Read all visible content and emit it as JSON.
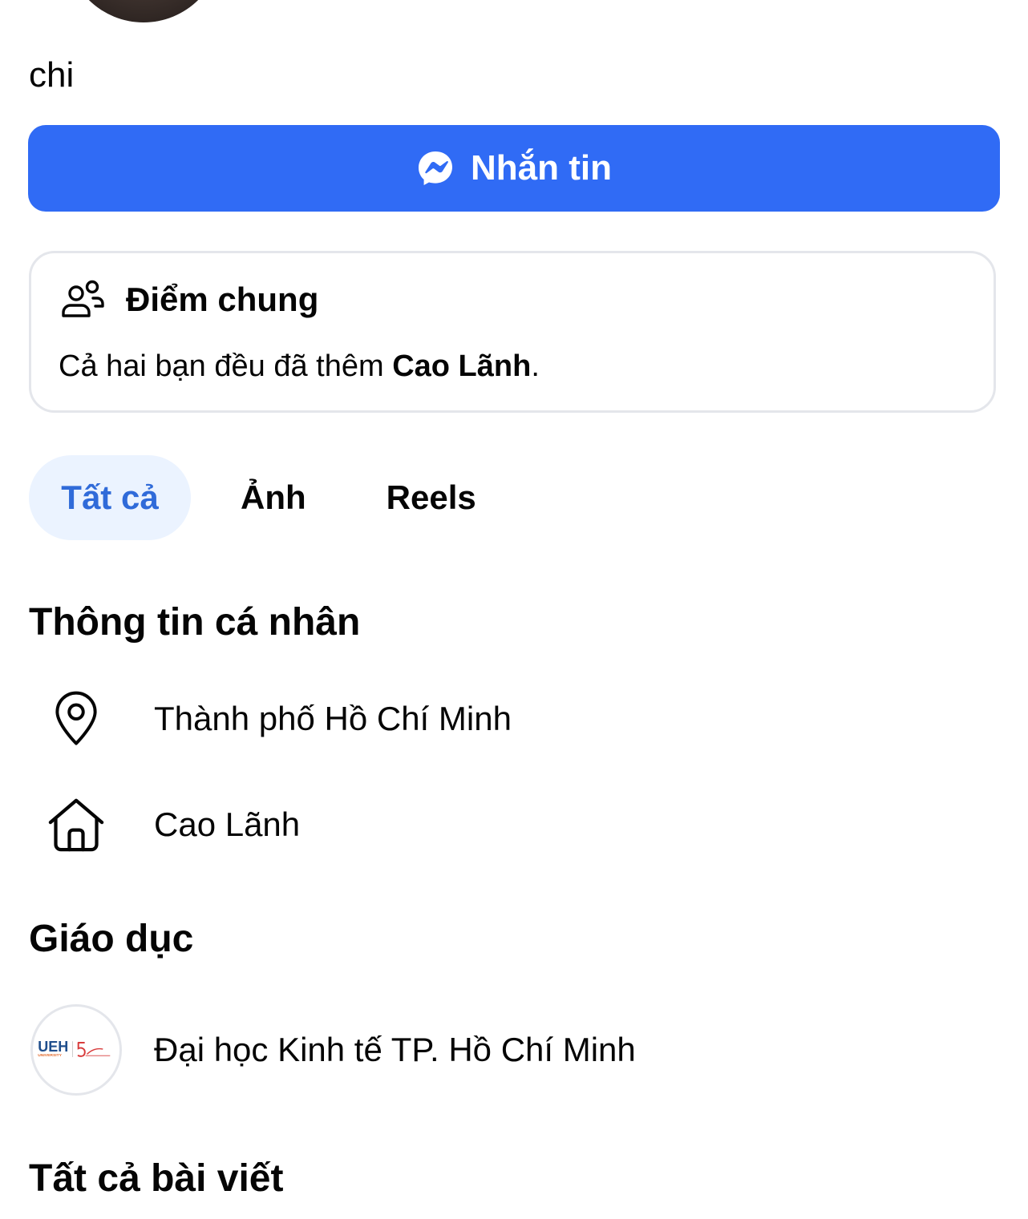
{
  "profile": {
    "name": "chi"
  },
  "actions": {
    "message_label": "Nhắn tin"
  },
  "common": {
    "title": "Điểm chung",
    "text_prefix": "Cả hai bạn đều đã thêm ",
    "text_bold": "Cao Lãnh",
    "text_suffix": "."
  },
  "tabs": [
    {
      "label": "Tất cả",
      "active": true
    },
    {
      "label": "Ảnh",
      "active": false
    },
    {
      "label": "Reels",
      "active": false
    }
  ],
  "personal_info": {
    "title": "Thông tin cá nhân",
    "items": [
      {
        "icon": "location-pin-icon",
        "text": "Thành phố Hồ Chí Minh"
      },
      {
        "icon": "home-icon",
        "text": "Cao Lãnh"
      }
    ]
  },
  "education": {
    "title": "Giáo dục",
    "items": [
      {
        "icon": "ueh-logo",
        "text": "Đại học Kinh tế TP. Hồ Chí Minh",
        "logo_text": "UEH",
        "logo_subtext": "UNIVERSITY"
      }
    ]
  },
  "posts": {
    "title": "Tất cả bài viết"
  },
  "colors": {
    "primary": "#306bf5",
    "active_tab_bg": "#ebf3ff",
    "active_tab_text": "#306bd9",
    "border": "#e4e6eb",
    "ueh_blue": "#1f4e8c",
    "ueh_orange": "#e26a2c"
  }
}
